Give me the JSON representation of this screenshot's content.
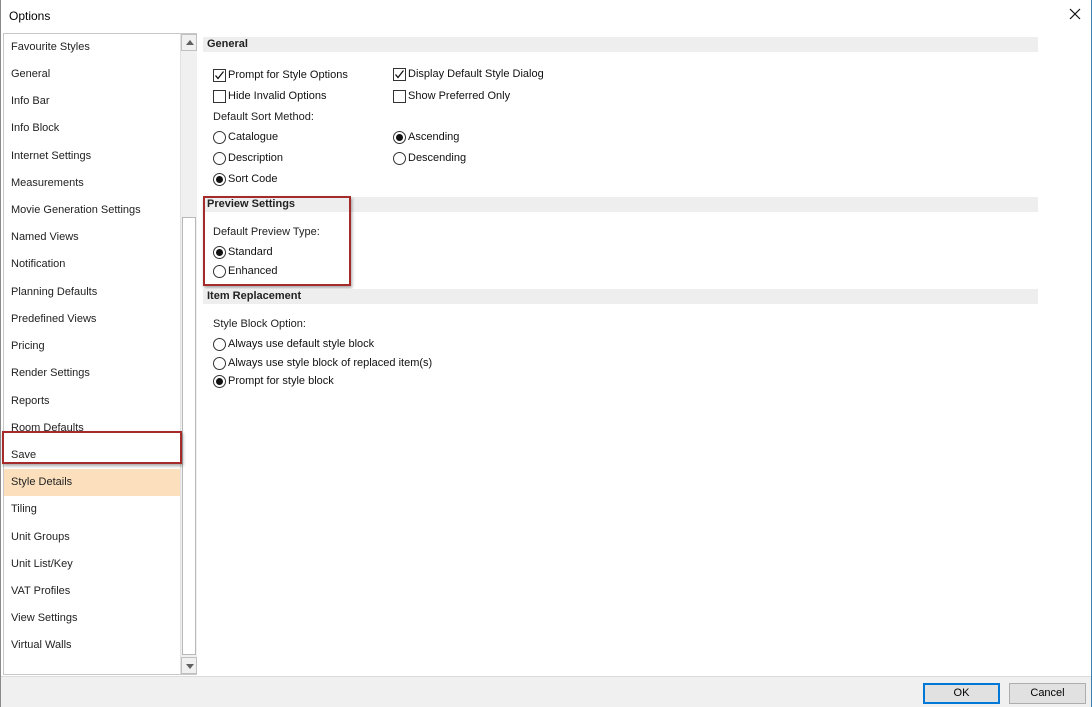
{
  "window": {
    "title": "Options"
  },
  "sidebar": {
    "items": [
      {
        "label": "Favourite Styles"
      },
      {
        "label": "General"
      },
      {
        "label": "Info Bar"
      },
      {
        "label": "Info Block"
      },
      {
        "label": "Internet Settings"
      },
      {
        "label": "Measurements"
      },
      {
        "label": "Movie Generation Settings"
      },
      {
        "label": "Named Views"
      },
      {
        "label": "Notification"
      },
      {
        "label": "Planning Defaults"
      },
      {
        "label": "Predefined Views"
      },
      {
        "label": "Pricing"
      },
      {
        "label": "Render Settings"
      },
      {
        "label": "Reports"
      },
      {
        "label": "Room Defaults"
      },
      {
        "label": "Save"
      },
      {
        "label": "Style Details"
      },
      {
        "label": "Tiling"
      },
      {
        "label": "Unit Groups"
      },
      {
        "label": "Unit List/Key"
      },
      {
        "label": "VAT Profiles"
      },
      {
        "label": "View Settings"
      },
      {
        "label": "Virtual Walls"
      }
    ],
    "selected": "Style Details"
  },
  "general": {
    "header": "General",
    "prompt_style_options": {
      "label": "Prompt for Style Options",
      "checked": true
    },
    "display_default_style_dialog": {
      "label": "Display Default Style Dialog",
      "checked": true
    },
    "hide_invalid_options": {
      "label": "Hide Invalid Options",
      "checked": false
    },
    "show_preferred_only": {
      "label": "Show Preferred Only",
      "checked": false
    },
    "sort_method_label": "Default Sort Method:",
    "sort_catalogue": {
      "label": "Catalogue",
      "selected": false
    },
    "sort_description": {
      "label": "Description",
      "selected": false
    },
    "sort_code": {
      "label": "Sort Code",
      "selected": true
    },
    "order_ascending": {
      "label": "Ascending",
      "selected": true
    },
    "order_descending": {
      "label": "Descending",
      "selected": false
    }
  },
  "preview": {
    "header": "Preview Settings",
    "type_label": "Default Preview Type:",
    "standard": {
      "label": "Standard",
      "selected": true
    },
    "enhanced": {
      "label": "Enhanced",
      "selected": false
    }
  },
  "replacement": {
    "header": "Item Replacement",
    "block_option_label": "Style Block Option:",
    "always_default": {
      "label": "Always use default style block",
      "selected": false
    },
    "always_replaced": {
      "label": "Always use style block of replaced item(s)",
      "selected": false
    },
    "prompt_block": {
      "label": "Prompt for style block",
      "selected": true
    }
  },
  "footer": {
    "ok_label": "OK",
    "cancel_label": "Cancel"
  },
  "colors": {
    "selection_bg": "#fce0be",
    "highlight_border": "#a52a2a",
    "ok_border": "#0078d7"
  }
}
